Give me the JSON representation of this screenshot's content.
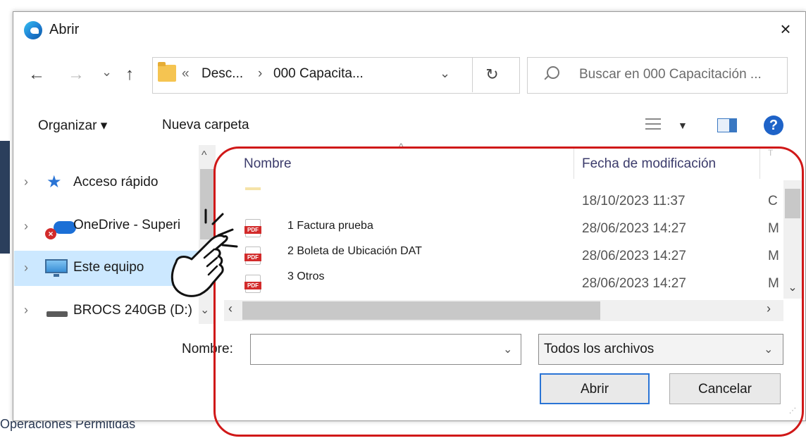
{
  "background": {
    "bottom_text": "Operaciones Permitidas"
  },
  "dialog": {
    "title": "Abrir",
    "close": "×"
  },
  "nav": {
    "back": "←",
    "forward": "→",
    "recent": "⌄",
    "up": "↑",
    "path_prefix": "«",
    "path_1": "Desc...",
    "path_sep": "›",
    "path_2": "000 Capacita...",
    "path_chevron": "⌄",
    "refresh": "↻",
    "search_placeholder": "Buscar en 000 Capacitación ..."
  },
  "toolbar": {
    "organize": "Organizar ▾",
    "new_folder": "Nueva carpeta",
    "view_caret": "▼",
    "help": "?"
  },
  "navpane": {
    "items": [
      {
        "label": "Acceso rápido",
        "chevron": "›",
        "icon": "star-icon"
      },
      {
        "label": "OneDrive - Superi",
        "chevron": "›",
        "icon": "onedrive-icon"
      },
      {
        "label": "Este equipo",
        "chevron": "›",
        "icon": "computer-icon"
      },
      {
        "label": "BROCS 240GB (D:)",
        "chevron": "›",
        "icon": "drive-icon",
        "suffix": "⌄"
      }
    ],
    "scroll_up": "^"
  },
  "filelist": {
    "columns": {
      "name": "Nombre",
      "date": "Fecha de modificación",
      "type": "T"
    },
    "sort_caret": "^",
    "files": [
      {
        "name": "",
        "date": "18/10/2023 11:37",
        "type": "C"
      },
      {
        "name": "1 Factura prueba",
        "date": "28/06/2023 14:27",
        "type": "M"
      },
      {
        "name": "2 Boleta de Ubicación DAT",
        "date": "28/06/2023 14:27",
        "type": "M"
      },
      {
        "name": "3 Otros",
        "date": "28/06/2023 14:27",
        "type": "M"
      }
    ],
    "scroll_down": "⌄",
    "scroll_left": "‹",
    "scroll_right": "›"
  },
  "footer": {
    "name_label": "Nombre:",
    "name_value": "",
    "name_chevron": "⌄",
    "file_type": "Todos los archivos",
    "type_chevron": "⌄",
    "open_button": "Abrir",
    "cancel_button": "Cancelar"
  },
  "colors": {
    "annotation": "#d01818",
    "selection": "#cce8ff",
    "accent": "#2a74d5"
  }
}
